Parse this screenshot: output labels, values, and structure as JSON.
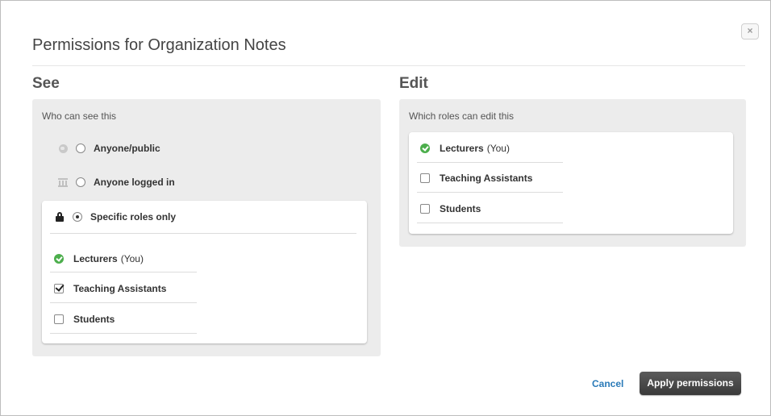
{
  "dialog": {
    "title": "Permissions for Organization Notes",
    "close_label": "×"
  },
  "see": {
    "heading": "See",
    "caption": "Who can see this",
    "options": [
      {
        "label": "Anyone/public",
        "icon": "globe-icon",
        "selected": false
      },
      {
        "label": "Anyone logged in",
        "icon": "institution-icon",
        "selected": false
      },
      {
        "label": "Specific roles only",
        "icon": "lock-icon",
        "selected": true
      }
    ],
    "roles": [
      {
        "label": "Lecturers",
        "suffix": "(You)",
        "state": "fixed"
      },
      {
        "label": "Teaching Assistants",
        "suffix": "",
        "state": "checked"
      },
      {
        "label": "Students",
        "suffix": "",
        "state": "unchecked"
      }
    ]
  },
  "edit": {
    "heading": "Edit",
    "caption": "Which roles can edit this",
    "roles": [
      {
        "label": "Lecturers",
        "suffix": "(You)",
        "state": "fixed"
      },
      {
        "label": "Teaching Assistants",
        "suffix": "",
        "state": "unchecked"
      },
      {
        "label": "Students",
        "suffix": "",
        "state": "unchecked"
      }
    ]
  },
  "footer": {
    "cancel_label": "Cancel",
    "apply_label": "Apply permissions"
  },
  "colors": {
    "accent_link": "#2a7ab8",
    "fixed_role": "#4cae4c",
    "primary_button": "#444444"
  }
}
